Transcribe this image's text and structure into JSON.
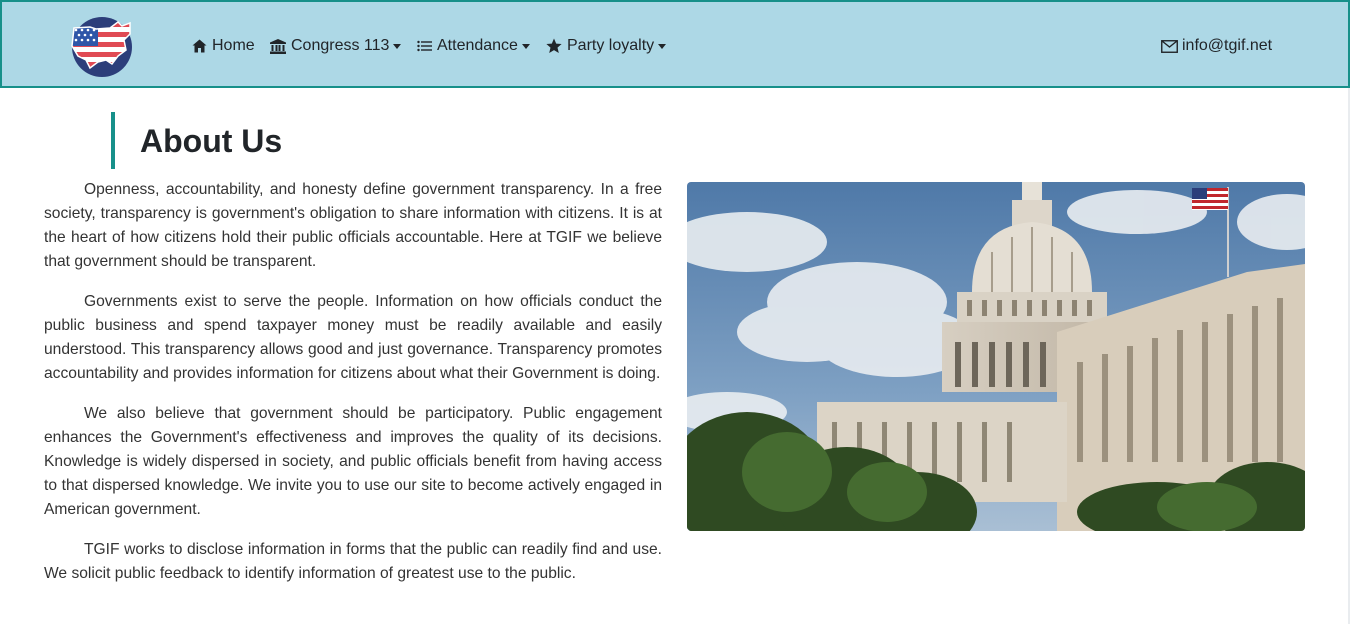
{
  "navbar": {
    "logo_name": "us-map-flag-logo",
    "items": [
      {
        "label": "Home",
        "icon": "home-icon",
        "dropdown": false
      },
      {
        "label": "Congress 113",
        "icon": "institution-icon",
        "dropdown": true
      },
      {
        "label": "Attendance",
        "icon": "list-icon",
        "dropdown": true
      },
      {
        "label": "Party loyalty",
        "icon": "star-icon",
        "dropdown": true
      }
    ],
    "email": {
      "label": "info@tgif.net",
      "icon": "envelope-icon"
    }
  },
  "main": {
    "title": "About Us",
    "paragraphs": [
      "Openness, accountability, and honesty define government transparency. In a free society, transparency is government's obligation to share information with citizens. It is at the heart of how citizens hold their public officials accountable. Here at TGIF we believe that government should be transparent.",
      "Governments exist to serve the people. Information on how officials conduct the public business and spend taxpayer money must be readily available and easily understood. This transparency allows good and just governance. Transparency promotes accountability and provides information for citizens about what their Government is doing.",
      "We also believe that government should be participatory. Public engagement enhances the Government's effectiveness and improves the quality of its decisions. Knowledge is widely dispersed in society, and public officials benefit from having access to that dispersed knowledge. We invite you to use our site to become actively engaged in American government.",
      "TGIF works to disclose information in forms that the public can readily find and use. We solicit public feedback to identify information of greatest use to the public."
    ],
    "image_subject": "us-capitol-building"
  },
  "colors": {
    "navbar_bg": "#add8e6",
    "accent": "#17908a",
    "text": "#212529"
  }
}
